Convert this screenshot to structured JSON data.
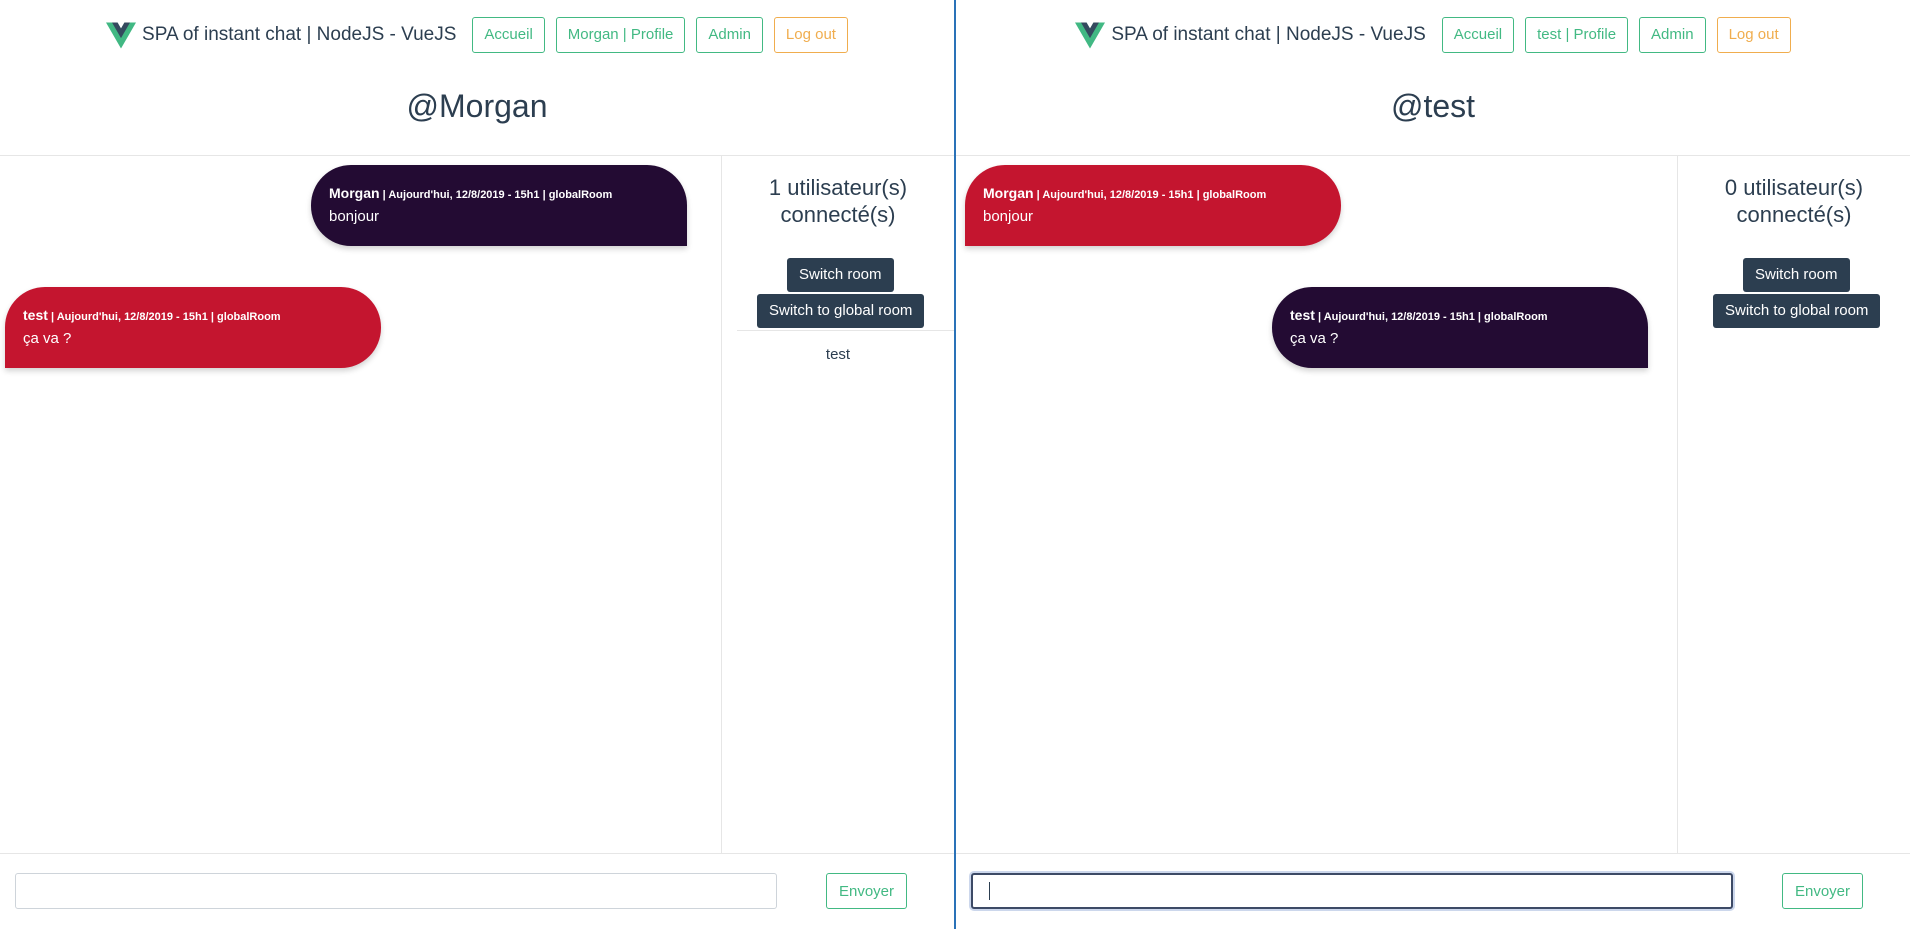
{
  "colors": {
    "accent_green": "#42b983",
    "warning_orange": "#f0ad4e",
    "own_bubble": "#230b33",
    "other_bubble": "#c4152f",
    "room_button": "#2c3e50",
    "divider": "#2a72b8"
  },
  "left": {
    "brand": "SPA of instant chat | NodeJS - VueJS",
    "nav": {
      "home": "Accueil",
      "profile": "Morgan | Profile",
      "admin": "Admin",
      "logout": "Log out"
    },
    "handle": "@Morgan",
    "messages": [
      {
        "author": "Morgan",
        "meta": " | Aujourd'hui, 12/8/2019 - 15h1 | globalRoom",
        "text": "bonjour"
      },
      {
        "author": "test",
        "meta": " | Aujourd'hui, 12/8/2019 - 15h1 | globalRoom",
        "text": "ça va ?"
      }
    ],
    "users_count_line1": "1 utilisateur(s)",
    "users_count_line2": "connecté(s)",
    "switch_room": "Switch room",
    "switch_global": "Switch to global room",
    "users": [
      "test"
    ],
    "input_value": "",
    "send": "Envoyer"
  },
  "right": {
    "brand": "SPA of instant chat | NodeJS - VueJS",
    "nav": {
      "home": "Accueil",
      "profile": "test | Profile",
      "admin": "Admin",
      "logout": "Log out"
    },
    "handle": "@test",
    "messages": [
      {
        "author": "Morgan",
        "meta": " | Aujourd'hui, 12/8/2019 - 15h1 | globalRoom",
        "text": "bonjour"
      },
      {
        "author": "test",
        "meta": " | Aujourd'hui, 12/8/2019 - 15h1 | globalRoom",
        "text": "ça va ?"
      }
    ],
    "users_count_line1": "0 utilisateur(s)",
    "users_count_line2": "connecté(s)",
    "switch_room": "Switch room",
    "switch_global": "Switch to global room",
    "input_value": "",
    "send": "Envoyer"
  }
}
